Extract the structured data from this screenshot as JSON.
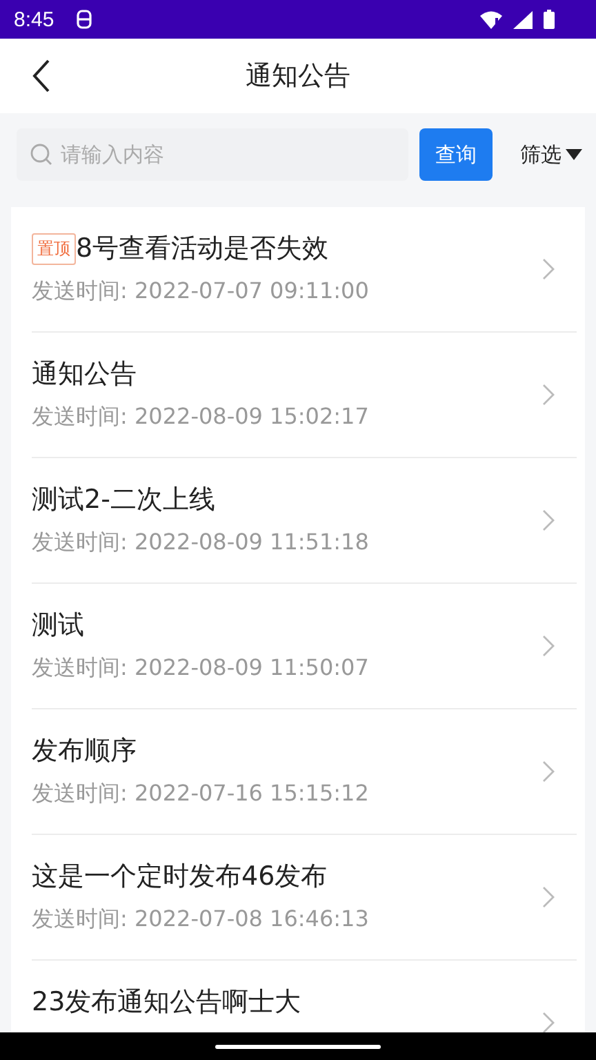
{
  "status_bar": {
    "time": "8:45"
  },
  "header": {
    "title": "通知公告"
  },
  "search": {
    "placeholder": "请输入内容",
    "button": "查询",
    "filter": "筛选"
  },
  "notices": [
    {
      "badge": "置顶",
      "title": "8号查看活动是否失效",
      "time": "发送时间: 2022-07-07 09:11:00"
    },
    {
      "title": "通知公告",
      "time": "发送时间: 2022-08-09 15:02:17"
    },
    {
      "title": "测试2-二次上线",
      "time": "发送时间: 2022-08-09 11:51:18"
    },
    {
      "title": "测试",
      "time": "发送时间: 2022-08-09 11:50:07"
    },
    {
      "title": "发布顺序",
      "time": "发送时间: 2022-07-16 15:15:12"
    },
    {
      "title": "这是一个定时发布46发布",
      "time": "发送时间: 2022-07-08 16:46:13"
    },
    {
      "title": "23发布通知公告啊士大"
    }
  ]
}
